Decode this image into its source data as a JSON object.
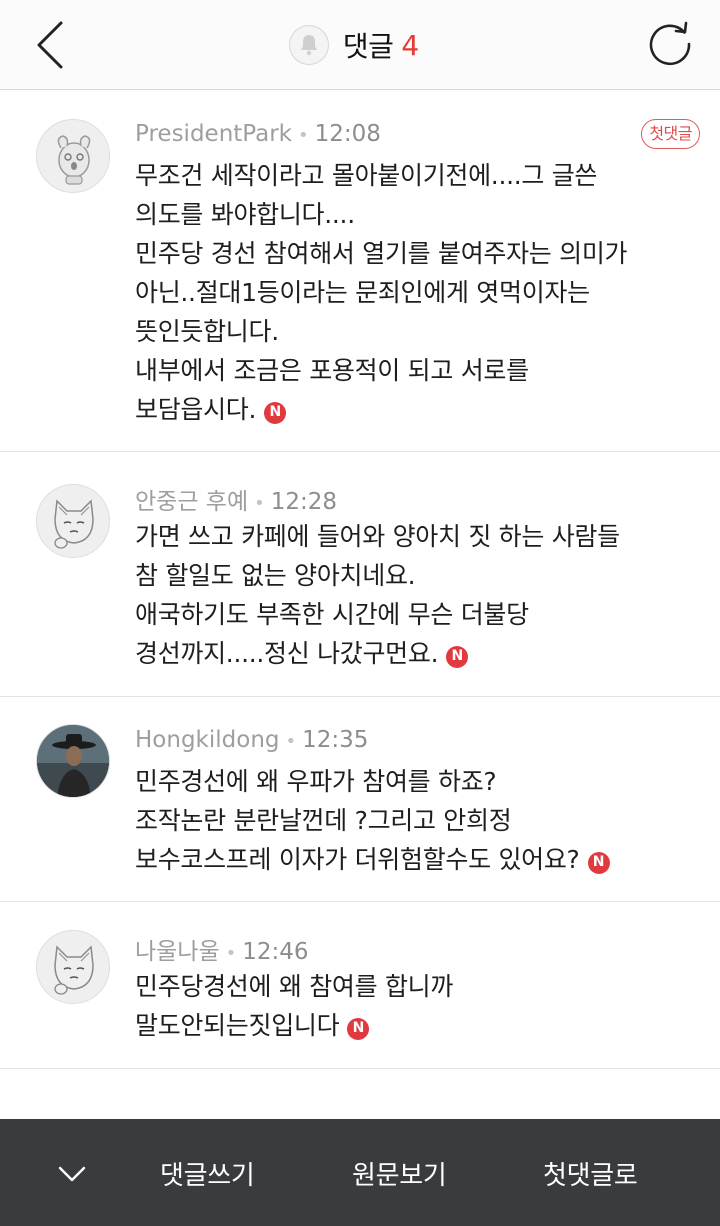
{
  "header": {
    "title": "댓글",
    "count": "4",
    "back_icon": "chevron-left-icon",
    "bell_icon": "bell-icon",
    "refresh_icon": "refresh-icon",
    "count_color": "#e53935"
  },
  "comments": [
    {
      "author": "PresidentPark",
      "time": "12:08",
      "badge": "첫댓글",
      "lines": [
        "무조건 세작이라고 몰아붙이기전에....그 글쓴",
        "의도를 봐야합니다....",
        "민주당 경선 참여해서 열기를 붙여주자는 의미가",
        "아닌..절대1등이라는 문죄인에게 엿먹이자는",
        "뜻인듯합니다.",
        "내부에서 조금은 포용적이 되고 서로를",
        "보담읍시다."
      ],
      "new_mark": "N"
    },
    {
      "author": "안중근 후예",
      "time": "12:28",
      "lines": [
        "가면 쓰고 카페에 들어와 양아치 짓 하는 사람들",
        "참 할일도 없는 양아치네요.",
        "애국하기도 부족한 시간에 무슨 더불당",
        "경선까지.....정신 나갔구먼요."
      ],
      "new_mark": "N"
    },
    {
      "author": "Hongkildong",
      "time": "12:35",
      "lines": [
        "민주경선에 왜 우파가 참여를 하죠?",
        "조작논란 분란날껀데 ?그리고 안희정",
        "보수코스프레 이자가 더위험할수도 있어요?"
      ],
      "new_mark": "N"
    },
    {
      "author": "나울나울",
      "time": "12:46",
      "lines": [
        "민주당경선에 왜 참여를 합니까",
        "말도안되는짓입니다"
      ],
      "new_mark": "N"
    }
  ],
  "bottom_bar": {
    "collapse_icon": "chevron-down-icon",
    "write": "댓글쓰기",
    "view_original": "원문보기",
    "first_comment": "첫댓글로",
    "background": "#3a3b3e"
  }
}
